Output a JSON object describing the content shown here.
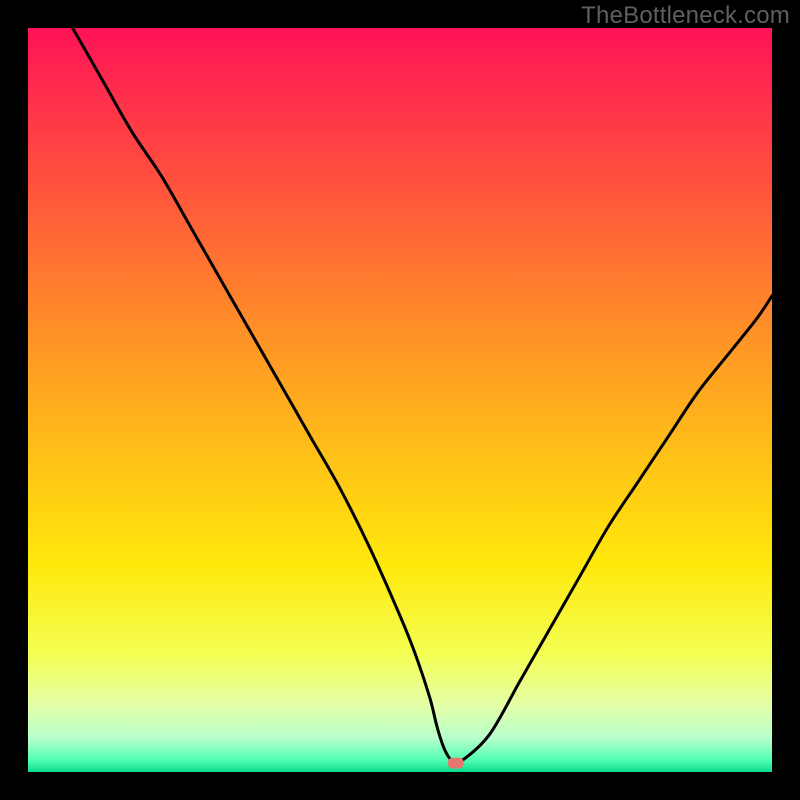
{
  "watermark": "TheBottleneck.com",
  "colors": {
    "frame": "#000000",
    "watermark": "#5f5f5f",
    "curve": "#000000",
    "marker": "#e4786f",
    "gradient_stops": [
      {
        "offset": 0.0,
        "color": "#ff1357"
      },
      {
        "offset": 0.2,
        "color": "#ff4f3e"
      },
      {
        "offset": 0.4,
        "color": "#ff8e28"
      },
      {
        "offset": 0.58,
        "color": "#ffc217"
      },
      {
        "offset": 0.72,
        "color": "#ffe80b"
      },
      {
        "offset": 0.84,
        "color": "#f4ff52"
      },
      {
        "offset": 0.91,
        "color": "#e3ffa7"
      },
      {
        "offset": 0.955,
        "color": "#b6ffcb"
      },
      {
        "offset": 0.985,
        "color": "#4dfdb1"
      },
      {
        "offset": 1.0,
        "color": "#0ada8e"
      }
    ]
  },
  "chart_data": {
    "type": "line",
    "title": "",
    "xlabel": "",
    "ylabel": "",
    "xlim": [
      0,
      100
    ],
    "ylim": [
      0,
      100
    ],
    "x": [
      6,
      10,
      14,
      18,
      22,
      26,
      30,
      34,
      38,
      42,
      46,
      50,
      52,
      54,
      55,
      56,
      57,
      58,
      62,
      66,
      70,
      74,
      78,
      82,
      86,
      90,
      94,
      98,
      100
    ],
    "values": [
      100,
      93,
      86,
      80,
      73,
      66,
      59,
      52,
      45,
      38,
      30,
      21,
      16,
      10,
      6,
      3,
      1.5,
      1.3,
      5,
      12,
      19,
      26,
      33,
      39,
      45,
      51,
      56,
      61,
      64
    ],
    "marker": {
      "x": 57.5,
      "y": 1.2
    },
    "grid": false,
    "legend": false
  }
}
